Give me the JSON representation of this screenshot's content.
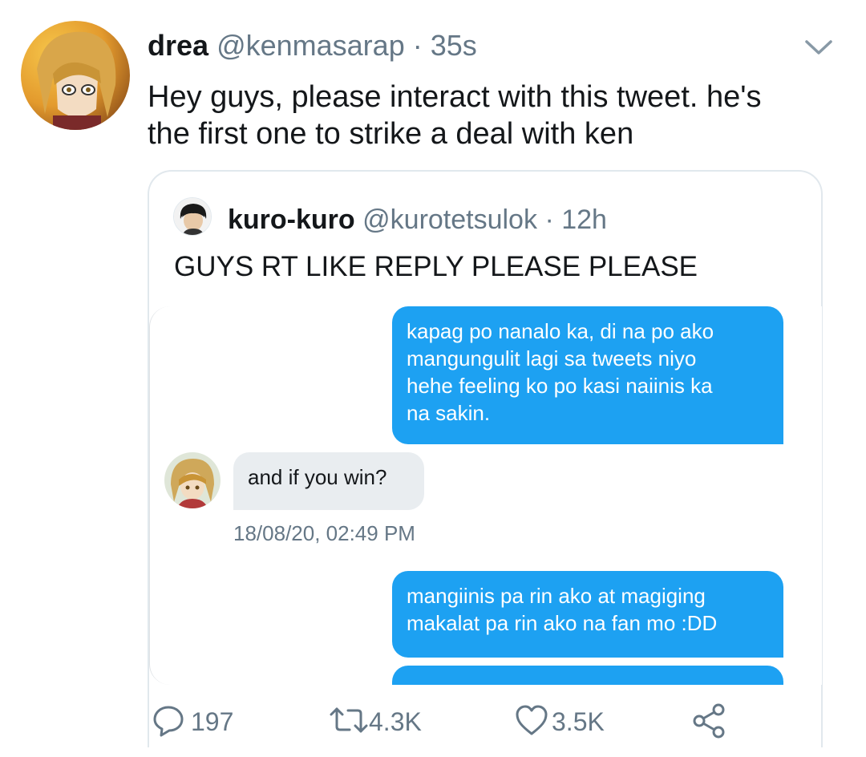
{
  "tweet": {
    "display_name": "drea",
    "handle": "@kenmasarap",
    "separator": "·",
    "time": "35s",
    "text_line1": "Hey guys, please interact with this tweet. he's",
    "text_line2": "the first one to strike a deal with ken"
  },
  "quote": {
    "display_name": "kuro-kuro",
    "handle": "@kurotetsulok",
    "separator": "·",
    "time": "12h",
    "text": "GUYS RT LIKE REPLY PLEASE PLEASE"
  },
  "dm": {
    "msg1_lines": [
      "kapag po nanalo ka, di na po ako",
      "mangungulit lagi sa tweets niyo",
      "hehe feeling ko po kasi naiinis ka",
      "na sakin."
    ],
    "msg2": "and if you win?",
    "timestamp": "18/08/20, 02:49 PM",
    "msg3_lines": [
      "mangiinis pa rin ako at magiging",
      "makalat pa rin ako na fan mo :DD"
    ]
  },
  "actions": {
    "replies": "197",
    "retweets": "4.3K",
    "likes": "3.5K"
  },
  "colors": {
    "accent": "#1da1f2",
    "secondary_text": "#657786",
    "border": "#e1e8ed",
    "incoming_bubble": "#e9edf0"
  },
  "icons": [
    "chevron-down-icon",
    "reply-icon",
    "retweet-icon",
    "like-icon",
    "share-icon"
  ]
}
